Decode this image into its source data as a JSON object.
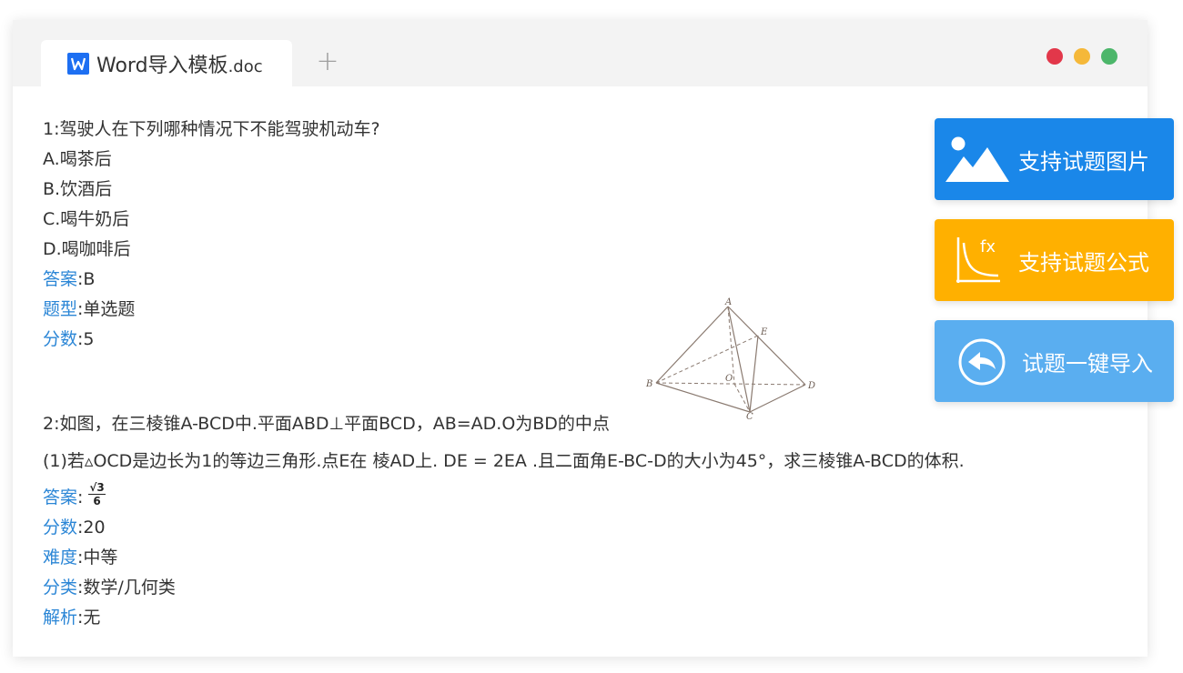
{
  "tab": {
    "title": "Word导入模板",
    "ext": ".doc",
    "new_tab": "+"
  },
  "window_controls": {
    "close_color": "#e2374a",
    "minimize_color": "#f5b839",
    "maximize_color": "#4cb66a"
  },
  "question1": {
    "stem": "1:驾驶人在下列哪种情况下不能驾驶机动车?",
    "options": [
      "A.喝茶后",
      "B.饮酒后",
      "C.喝牛奶后",
      "D.喝咖啡后"
    ],
    "answer_label": "答案",
    "answer": ":B",
    "type_label": "题型",
    "type": ":单选题",
    "score_label": "分数",
    "score": ":5"
  },
  "question2": {
    "stem": "2:如图，在三棱锥A-BCD中.平面ABD⊥平面BCD，AB=AD.O为BD的中点",
    "subq": "(1)若▵OCD是边长为1的等边三角形.点E在 棱AD上. DE = 2EA .且二面角E-BC-D的大小为45°，求三棱锥A-BCD的体积.",
    "answer_label": "答案",
    "answer_colon": ":",
    "answer_num": "√3",
    "answer_den": "6",
    "score_label": "分数",
    "score": ":20",
    "difficulty_label": "难度",
    "difficulty": ":中等",
    "category_label": "分类",
    "category": ":数学/几何类",
    "analysis_label": "解析",
    "analysis": ":无",
    "figure_labels": {
      "A": "A",
      "B": "B",
      "C": "C",
      "D": "D",
      "E": "E",
      "O": "O"
    }
  },
  "features": {
    "image_label": "支持试题图片",
    "formula_label": "支持试题公式",
    "formula_icon_text": "fx",
    "import_label": "试题一键导入"
  },
  "colors": {
    "accent": "#2b86d6",
    "blue": "#1a87e9",
    "yellow": "#ffb000",
    "light_blue": "#5aaef0"
  }
}
